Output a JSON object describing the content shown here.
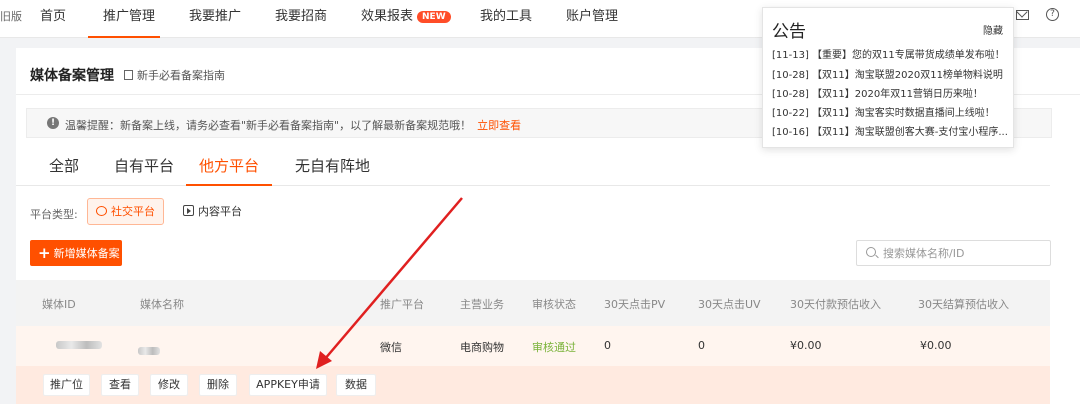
{
  "topnav": {
    "version_label": "旧版",
    "items": [
      {
        "label": "首页"
      },
      {
        "label": "推广管理"
      },
      {
        "label": "我要推广"
      },
      {
        "label": "我要招商"
      },
      {
        "label": "效果报表",
        "badge": "NEW"
      },
      {
        "label": "我的工具"
      },
      {
        "label": "账户管理"
      }
    ],
    "active_index": 1,
    "icons": [
      "mail-icon",
      "help-icon"
    ]
  },
  "page": {
    "title": "媒体备案管理",
    "guide_link": "新手必看备案指南",
    "notice": {
      "text": "温馨提醒：新备案上线，请务必查看\"新手必看备案指南\"，以了解最新备案规范哦！",
      "link": "立即查看"
    },
    "tabs": [
      {
        "label": "全部"
      },
      {
        "label": "自有平台"
      },
      {
        "label": "他方平台"
      },
      {
        "label": "无自有阵地"
      }
    ],
    "active_tab": 2,
    "platform_type": {
      "label": "平台类型:",
      "options": [
        {
          "label": "社交平台",
          "selected": true
        },
        {
          "label": "内容平台",
          "selected": false
        }
      ]
    },
    "add_button": "新增媒体备案",
    "search_placeholder": "搜索媒体名称/ID",
    "table": {
      "columns": [
        "媒体ID",
        "媒体名称",
        "推广平台",
        "主营业务",
        "审核状态",
        "30天点击PV",
        "30天点击UV",
        "30天付款预估收入",
        "30天结算预估收入"
      ],
      "rows": [
        {
          "media_id": "",
          "media_name": "",
          "platform": "微信",
          "business": "电商购物",
          "status": "审核通过",
          "pv": "0",
          "uv": "0",
          "pay_income": "¥0.00",
          "settle_income": "¥0.00"
        }
      ],
      "row_actions": [
        "推广位",
        "查看",
        "修改",
        "删除",
        "APPKEY申请",
        "数据"
      ]
    }
  },
  "announcement": {
    "title": "公告",
    "hide_label": "隐藏",
    "items": [
      "[11-13]  【重要】您的双11专属带货成绩单发布啦！",
      "[10-28]  【双11】淘宝联盟2020双11榜单物料说明",
      "[10-28]  【双11】2020年双11营销日历来啦！",
      "[10-22]  【双11】淘宝客实时数据直播间上线啦！",
      "[10-16]  【双11】淘宝联盟创客大赛-支付宝小程序..."
    ]
  },
  "colors": {
    "accent": "#ff5000",
    "status_ok": "#7ab33a",
    "arrow": "#e02020"
  }
}
